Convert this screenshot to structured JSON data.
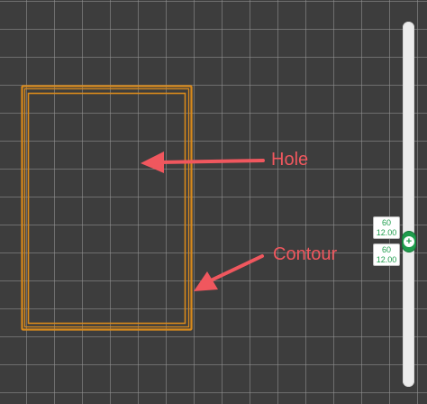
{
  "annotations": {
    "hole_label": "Hole",
    "contour_label": "Contour",
    "color": "#f0575e"
  },
  "part": {
    "outline_color": "#d98a1c"
  },
  "slider": {
    "track_color": "#ececec",
    "thumb_color": "#1f9d4d",
    "thumb_icon": "plus-icon",
    "upper_tag": {
      "layer": "60",
      "height": "12.00"
    },
    "lower_tag": {
      "layer": "60",
      "height": "12.00"
    }
  }
}
